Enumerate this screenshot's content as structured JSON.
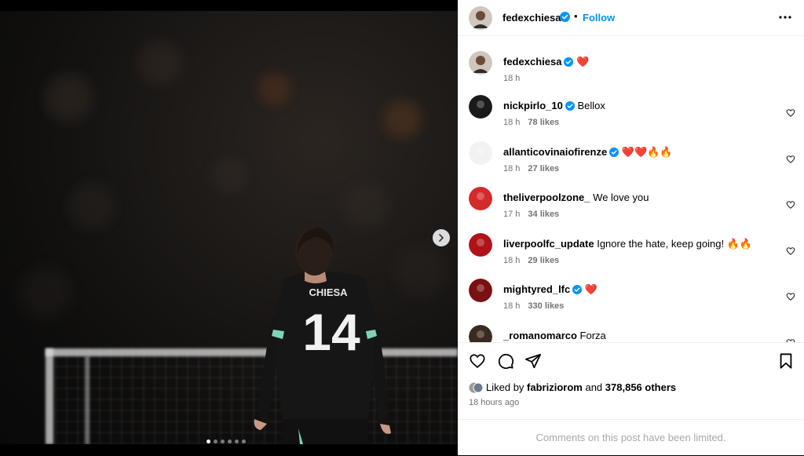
{
  "post": {
    "author": "fedexchiesa",
    "follow_label": "Follow",
    "separator": "•",
    "caption": "❤️",
    "caption_time": "18 h",
    "jersey_name": "CHIESA",
    "jersey_number": "14",
    "carousel": {
      "count": 6,
      "active_index": 0
    }
  },
  "comments": [
    {
      "user": "nickpirlo_10",
      "verified": true,
      "text": "Bellox",
      "time": "18 h",
      "likes": "78 likes",
      "avatar_color": "#1a1a1a"
    },
    {
      "user": "allanticovinaiofirenze",
      "verified": true,
      "text": "❤️❤️🔥🔥",
      "time": "18 h",
      "likes": "27 likes",
      "avatar_color": "#f2f2f2"
    },
    {
      "user": "theliverpoolzone_",
      "verified": false,
      "text": "We love you",
      "time": "17 h",
      "likes": "34 likes",
      "avatar_color": "#d32a2a"
    },
    {
      "user": "liverpoolfc_update",
      "verified": false,
      "text": "Ignore the hate, keep going! 🔥🔥",
      "time": "18 h",
      "likes": "29 likes",
      "avatar_color": "#b01217"
    },
    {
      "user": "mightyred_lfc",
      "verified": true,
      "text": "❤️",
      "time": "18 h",
      "likes": "330 likes",
      "avatar_color": "#7a1010"
    },
    {
      "user": "_romanomarco",
      "verified": false,
      "text": "Forza",
      "time": "",
      "likes": "",
      "avatar_color": "#3a2a20"
    }
  ],
  "liked_by": {
    "prefix": "Liked by",
    "user": "fabriziorom",
    "and": "and",
    "others": "378,856 others"
  },
  "time_ago": "18 hours ago",
  "comments_limited": "Comments on this post have been limited.",
  "colors": {
    "accent": "#0095f6",
    "verified": "#0095f6",
    "muted": "#737373"
  }
}
